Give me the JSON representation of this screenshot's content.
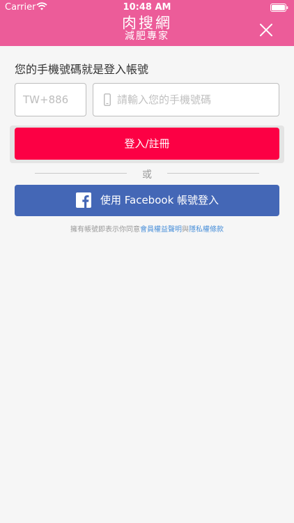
{
  "status_bar": {
    "carrier": "Carrier",
    "time": "10:48 AM"
  },
  "header": {
    "logo_line1": "肉搜網",
    "logo_line2": "減肥專家",
    "background_color": "#ec5c99"
  },
  "form": {
    "prompt": "您的手機號碼就是登入帳號",
    "country_code": "TW+886",
    "phone_placeholder": "請輸入您的手機號碼",
    "login_button": "登入/註冊",
    "divider_text": "或",
    "facebook_button": "使用 Facebook 帳號登入"
  },
  "terms": {
    "prefix": "擁有帳號即表示你同意",
    "member_rights_link": "會員權益聲明",
    "conjunction": "與",
    "privacy_link": "隱私權條款"
  },
  "colors": {
    "accent": "#fc0044",
    "facebook": "#4467b6",
    "link": "#4a90d9"
  }
}
